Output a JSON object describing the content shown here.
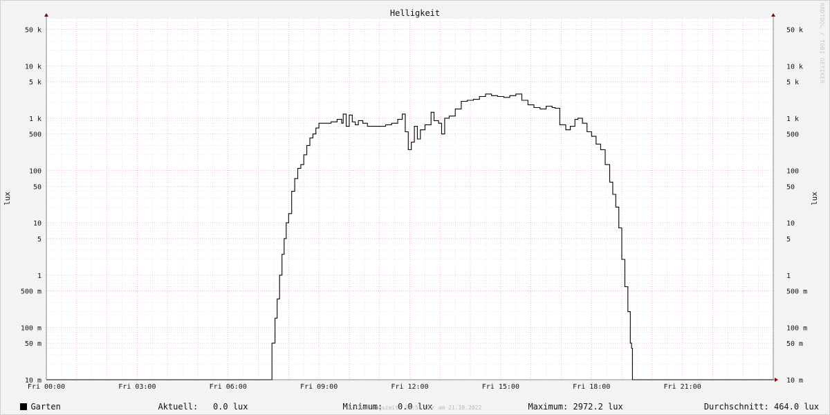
{
  "chart_data": {
    "type": "line",
    "title": "Helligkeit",
    "ylabel": "lux",
    "y_scale": "log",
    "ylim": [
      0.01,
      80000
    ],
    "xlim_hours": [
      0,
      24
    ],
    "grid": true,
    "y_ticks": [
      {
        "value": 50000,
        "label": "50 k"
      },
      {
        "value": 10000,
        "label": "10 k"
      },
      {
        "value": 5000,
        "label": "5 k"
      },
      {
        "value": 1000,
        "label": "1 k"
      },
      {
        "value": 500,
        "label": "500"
      },
      {
        "value": 100,
        "label": "100"
      },
      {
        "value": 50,
        "label": "50"
      },
      {
        "value": 10,
        "label": "10"
      },
      {
        "value": 5,
        "label": "5"
      },
      {
        "value": 1,
        "label": "1"
      },
      {
        "value": 0.5,
        "label": "500 m"
      },
      {
        "value": 0.1,
        "label": "100 m"
      },
      {
        "value": 0.05,
        "label": "50 m"
      },
      {
        "value": 0.01,
        "label": "10 m"
      }
    ],
    "x_ticks": [
      {
        "hour": 0,
        "label": "Fri 00:00"
      },
      {
        "hour": 3,
        "label": "Fri 03:00"
      },
      {
        "hour": 6,
        "label": "Fri 06:00"
      },
      {
        "hour": 9,
        "label": "Fri 09:00"
      },
      {
        "hour": 12,
        "label": "Fri 12:00"
      },
      {
        "hour": 15,
        "label": "Fri 15:00"
      },
      {
        "hour": 18,
        "label": "Fri 18:00"
      },
      {
        "hour": 21,
        "label": "Fri 21:00"
      }
    ],
    "series": [
      {
        "name": "Garten",
        "color": "#000000",
        "points": [
          [
            0,
            0.01
          ],
          [
            7.4,
            0.01
          ],
          [
            7.45,
            0.05
          ],
          [
            7.55,
            0.15
          ],
          [
            7.62,
            0.35
          ],
          [
            7.7,
            1
          ],
          [
            7.78,
            2.5
          ],
          [
            7.85,
            5
          ],
          [
            7.92,
            10
          ],
          [
            8.0,
            15
          ],
          [
            8.1,
            40
          ],
          [
            8.2,
            70
          ],
          [
            8.3,
            110
          ],
          [
            8.4,
            130
          ],
          [
            8.5,
            200
          ],
          [
            8.6,
            300
          ],
          [
            8.7,
            420
          ],
          [
            8.8,
            500
          ],
          [
            8.9,
            650
          ],
          [
            9.0,
            800
          ],
          [
            9.2,
            800
          ],
          [
            9.4,
            850
          ],
          [
            9.6,
            950
          ],
          [
            9.75,
            800
          ],
          [
            9.8,
            1200
          ],
          [
            9.9,
            700
          ],
          [
            10.0,
            1150
          ],
          [
            10.1,
            850
          ],
          [
            10.2,
            750
          ],
          [
            10.3,
            900
          ],
          [
            10.45,
            800
          ],
          [
            10.6,
            700
          ],
          [
            10.8,
            700
          ],
          [
            11.0,
            700
          ],
          [
            11.2,
            750
          ],
          [
            11.4,
            800
          ],
          [
            11.6,
            950
          ],
          [
            11.75,
            1200
          ],
          [
            11.85,
            550
          ],
          [
            11.95,
            250
          ],
          [
            12.05,
            350
          ],
          [
            12.15,
            700
          ],
          [
            12.25,
            400
          ],
          [
            12.35,
            600
          ],
          [
            12.5,
            750
          ],
          [
            12.7,
            1300
          ],
          [
            12.8,
            900
          ],
          [
            12.95,
            800
          ],
          [
            13.05,
            500
          ],
          [
            13.15,
            1000
          ],
          [
            13.3,
            1100
          ],
          [
            13.5,
            1500
          ],
          [
            13.7,
            2100
          ],
          [
            13.9,
            2200
          ],
          [
            14.1,
            2300
          ],
          [
            14.3,
            2600
          ],
          [
            14.5,
            2900
          ],
          [
            14.7,
            2700
          ],
          [
            14.9,
            2600
          ],
          [
            15.1,
            2500
          ],
          [
            15.3,
            2700
          ],
          [
            15.5,
            2900
          ],
          [
            15.7,
            2200
          ],
          [
            15.9,
            1800
          ],
          [
            16.1,
            1600
          ],
          [
            16.3,
            1500
          ],
          [
            16.5,
            1700
          ],
          [
            16.7,
            1600
          ],
          [
            16.8,
            1550
          ],
          [
            16.95,
            750
          ],
          [
            17.15,
            600
          ],
          [
            17.3,
            700
          ],
          [
            17.45,
            950
          ],
          [
            17.55,
            1000
          ],
          [
            17.7,
            800
          ],
          [
            17.85,
            550
          ],
          [
            18.0,
            450
          ],
          [
            18.15,
            320
          ],
          [
            18.3,
            250
          ],
          [
            18.45,
            130
          ],
          [
            18.6,
            60
          ],
          [
            18.7,
            35
          ],
          [
            18.8,
            20
          ],
          [
            18.9,
            8
          ],
          [
            19.0,
            2
          ],
          [
            19.1,
            0.6
          ],
          [
            19.2,
            0.2
          ],
          [
            19.28,
            0.05
          ],
          [
            19.32,
            0.04
          ],
          [
            19.35,
            0.01
          ],
          [
            24,
            0.01
          ]
        ]
      }
    ],
    "stats": {
      "current_label": "Aktuell:",
      "current_value": "0.0 lux",
      "min_label": "Minimum:",
      "min_value": "0.0 lux",
      "max_label": "Maximum:",
      "max_value": "2972.2 lux",
      "avg_label": "Durchschnitt:",
      "avg_value": "464.0 lux"
    }
  },
  "footer": "Erstellungszeit: 23:55 Uhr am 21.10.2022",
  "watermark": "RRDTOOL / TOBI OETIKER"
}
